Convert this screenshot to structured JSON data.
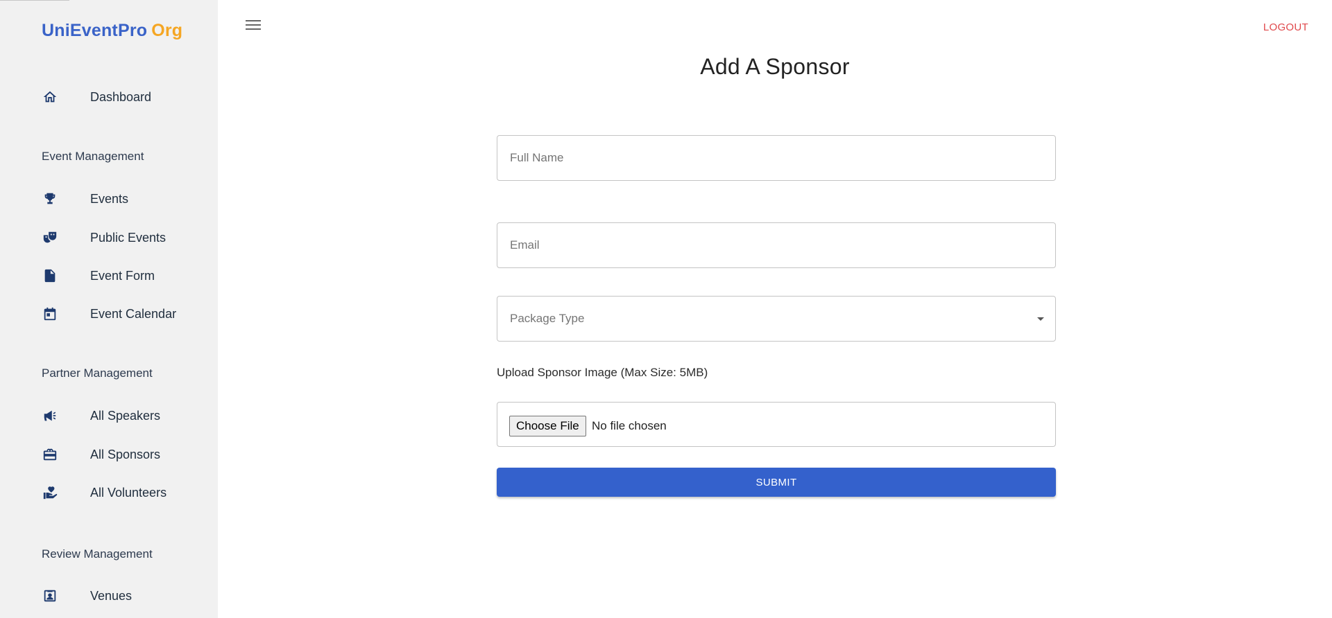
{
  "app": {
    "brand_main": "UniEventPro",
    "brand_accent": "Org",
    "brand_color": "#3a63c8",
    "accent_color": "#f5a623"
  },
  "sidebar": {
    "dashboard": {
      "label": "Dashboard",
      "icon": "home-icon"
    },
    "sections": [
      {
        "title": "Event Management",
        "items": [
          {
            "label": "Events",
            "icon": "trophy-icon"
          },
          {
            "label": "Public Events",
            "icon": "theater-masks-icon"
          },
          {
            "label": "Event Form",
            "icon": "document-icon"
          },
          {
            "label": "Event Calendar",
            "icon": "calendar-icon"
          }
        ]
      },
      {
        "title": "Partner Management",
        "items": [
          {
            "label": "All Speakers",
            "icon": "megaphone-icon"
          },
          {
            "label": "All Sponsors",
            "icon": "gift-card-icon"
          },
          {
            "label": "All Volunteers",
            "icon": "hand-heart-icon"
          }
        ]
      },
      {
        "title": "Review Management",
        "items": [
          {
            "label": "Venues",
            "icon": "contact-card-icon"
          }
        ]
      }
    ]
  },
  "header": {
    "logout_label": "LOGOUT",
    "logout_color": "#e0484b",
    "menu_icon": "hamburger-menu-icon"
  },
  "form": {
    "title": "Add A Sponsor",
    "full_name": {
      "placeholder": "Full Name",
      "value": ""
    },
    "email": {
      "placeholder": "Email",
      "value": ""
    },
    "package_type": {
      "placeholder": "Package Type"
    },
    "upload_label": "Upload Sponsor Image (Max Size: 5MB)",
    "choose_file_label": "Choose File",
    "file_status": "No file chosen",
    "submit_label": "SUBMIT",
    "submit_color": "#3461cc"
  }
}
